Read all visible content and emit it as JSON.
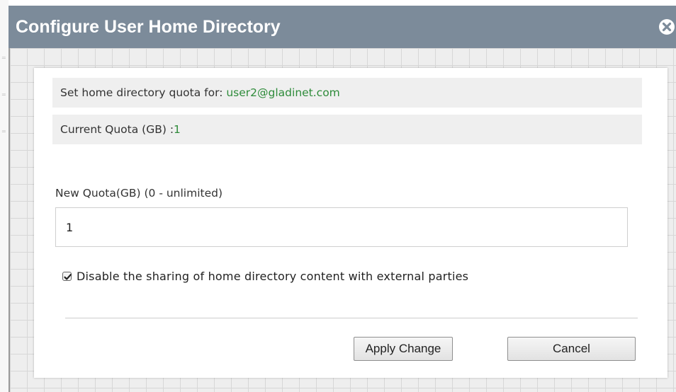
{
  "dialog": {
    "title": "Configure User Home Directory",
    "close_icon": "close-circle-icon"
  },
  "info": {
    "quota_for_label": "Set home directory quota for: ",
    "quota_for_value": "user2@gladinet.com",
    "current_quota_label": "Current Quota (GB) :",
    "current_quota_value": "1"
  },
  "form": {
    "new_quota_label": "New Quota(GB) (0 - unlimited)",
    "new_quota_value": "1",
    "disable_sharing_checked": true,
    "disable_sharing_label": "Disable the sharing of home directory content with external parties"
  },
  "buttons": {
    "apply_label": "Apply Change",
    "cancel_label": "Cancel"
  },
  "colors": {
    "titlebar": "#7c8b9a",
    "value_green": "#2e8b3a"
  }
}
